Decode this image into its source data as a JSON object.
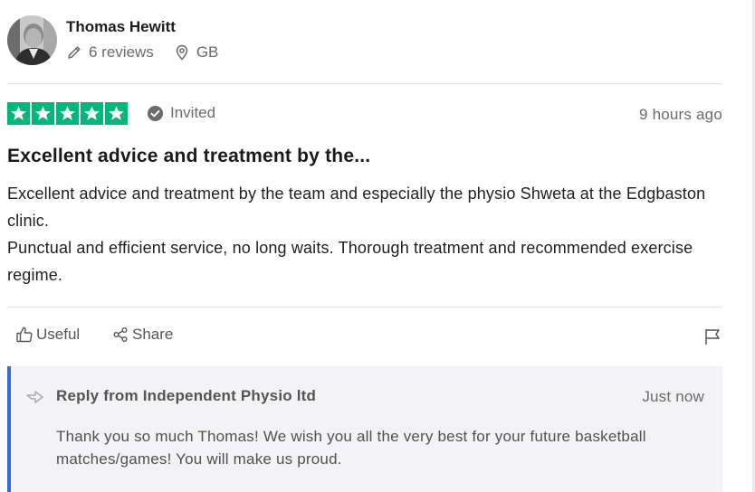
{
  "reviewer": {
    "name": "Thomas Hewitt",
    "reviews_count": "6 reviews",
    "country": "GB"
  },
  "review": {
    "stars": 5,
    "star_color": "#00b67a",
    "invited_label": "Invited",
    "time": "9 hours ago",
    "title": "Excellent advice and treatment by the...",
    "body_line1": "Excellent advice and treatment by the team and especially the physio Shweta at the Edgbaston clinic.",
    "body_line2": "Punctual and efficient service, no long waits. Thorough treatment and recommended exercise regime."
  },
  "actions": {
    "useful_label": "Useful",
    "share_label": "Share",
    "flag_icon": "flag-icon"
  },
  "reply": {
    "from": "Reply from Independent Physio ltd",
    "time": "Just now",
    "text": "Thank you so much Thomas! We wish you all the very best for your future basketball matches/games! You will make us proud.",
    "accent_color": "#3c68e8"
  }
}
